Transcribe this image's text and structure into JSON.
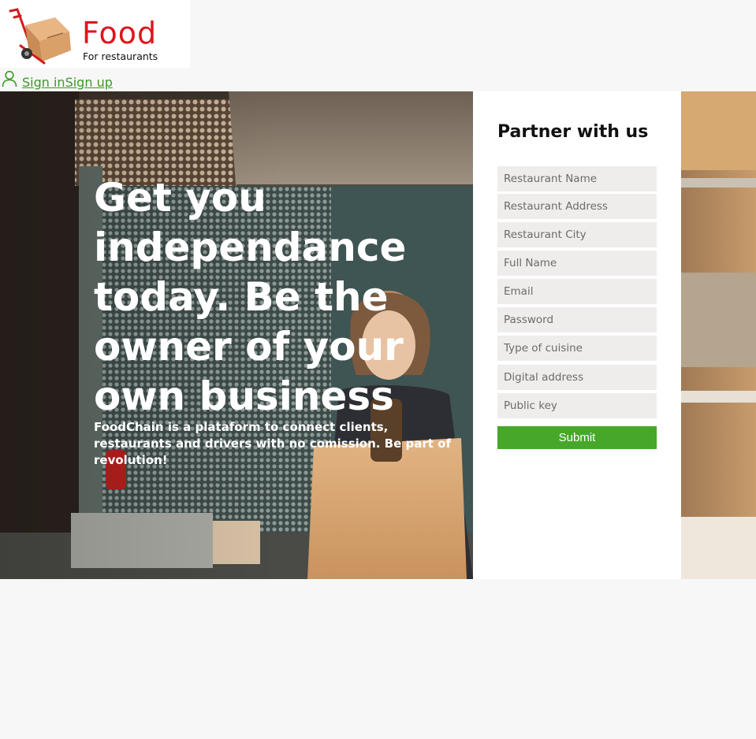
{
  "brand": {
    "logo_word": "Food",
    "logo_tagline": "For restaurants"
  },
  "auth": {
    "sign_in_label": "Sign in",
    "sign_up_label": "Sign up"
  },
  "hero": {
    "headline": "Get you independance today. Be the owner of your own business",
    "subtext": "FoodChain is a plataform to connect clients, restaurants and drivers with no comission. Be part of revolution!"
  },
  "form": {
    "title": "Partner with us",
    "fields": [
      {
        "placeholder": "Restaurant Name",
        "value": ""
      },
      {
        "placeholder": "Restaurant Address",
        "value": ""
      },
      {
        "placeholder": "Restaurant City",
        "value": ""
      },
      {
        "placeholder": "Full Name",
        "value": ""
      },
      {
        "placeholder": "Email",
        "value": ""
      },
      {
        "placeholder": "Password",
        "value": ""
      },
      {
        "placeholder": "Type of cuisine",
        "value": ""
      },
      {
        "placeholder": "Digital address",
        "value": ""
      },
      {
        "placeholder": "Public key",
        "value": ""
      }
    ],
    "submit_label": "Submit"
  },
  "colors": {
    "accent_green": "#47a72a",
    "link_green": "#3a9a27",
    "logo_red": "#e0141c",
    "field_bg": "#efecec"
  },
  "icons": {
    "logo_art": "hand-truck-with-box",
    "auth_icon": "user-icon"
  }
}
